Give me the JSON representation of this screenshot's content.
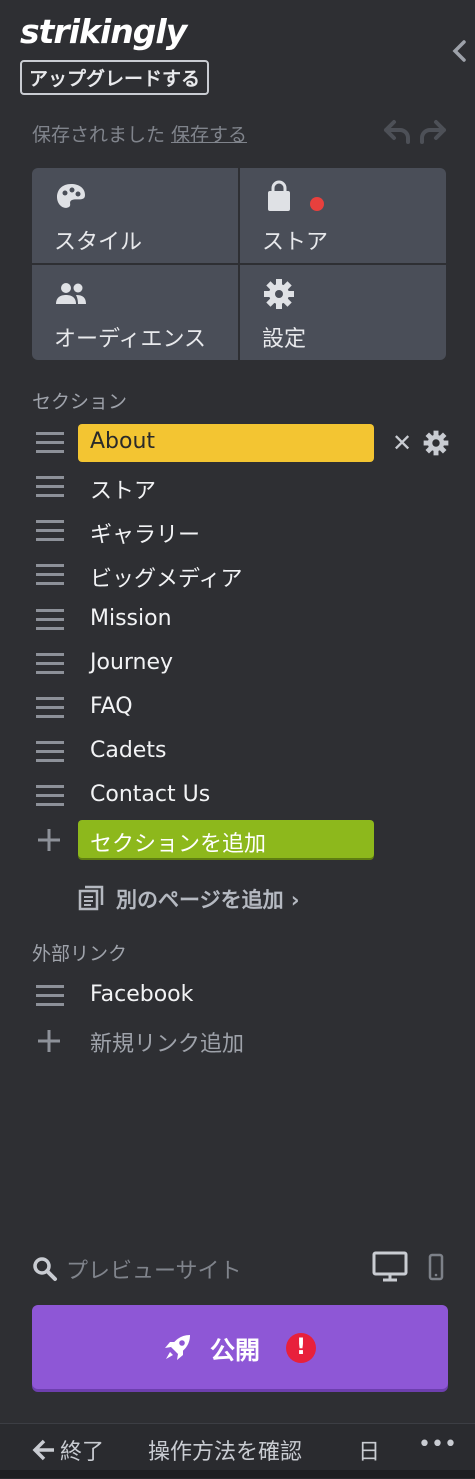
{
  "brand": {
    "logo": "strikingly",
    "upgrade_label": "アップグレードする"
  },
  "status": {
    "saved_text": "保存されました",
    "save_link": "保存する"
  },
  "tiles": [
    {
      "label": "スタイル",
      "icon": "palette-icon"
    },
    {
      "label": "ストア",
      "icon": "shopping-bag-icon",
      "badge": "red-dot"
    },
    {
      "label": "オーディエンス",
      "icon": "people-icon"
    },
    {
      "label": "設定",
      "icon": "gear-icon"
    }
  ],
  "sections": {
    "heading": "セクション",
    "items": [
      {
        "label": "About",
        "active": true
      },
      {
        "label": "ストア"
      },
      {
        "label": "ギャラリー"
      },
      {
        "label": "ビッグメディア"
      },
      {
        "label": "Mission"
      },
      {
        "label": "Journey"
      },
      {
        "label": "FAQ"
      },
      {
        "label": "Cadets"
      },
      {
        "label": "Contact Us"
      }
    ],
    "add_section": "セクションを追加",
    "add_page": "別のページを追加"
  },
  "external_links": {
    "heading": "外部リンク",
    "items": [
      {
        "label": "Facebook"
      }
    ],
    "add_link": "新規リンク追加"
  },
  "preview": {
    "label": "プレビューサイト"
  },
  "publish": {
    "label": "公開",
    "alert": "!"
  },
  "footer": {
    "exit": "終了",
    "help": "操作方法を確認",
    "lang": "日",
    "more": "•••"
  },
  "colors": {
    "active_section": "#f3c532",
    "add_section": "#8db81c",
    "publish": "#8e57d6",
    "alert": "#e8203b",
    "badge": "#e8403d"
  }
}
